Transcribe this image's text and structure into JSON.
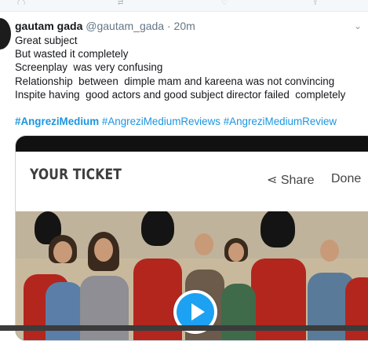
{
  "tweet": {
    "display_name": "gautam gada",
    "handle": "@gautam_gada",
    "separator": " · ",
    "timestamp": "20m",
    "lines": [
      "Great subject",
      "But wasted it completely",
      "Screenplay  was very confusing",
      "Relationship  between  dimple mam and kareena was not convincing",
      "Inspite having  good actors and good subject director failed  completely"
    ],
    "hashtags": [
      "#AngreziMedium",
      "#AngreziMediumReviews",
      "#AngreziMediumReview"
    ]
  },
  "card": {
    "ticket_title": "YOUR TICKET",
    "share_label": "Share",
    "done_label": "Done"
  },
  "colors": {
    "link": "#1b95e0",
    "play_button": "#1da1f2"
  },
  "icons": {
    "share": "share-icon",
    "play": "play-icon",
    "chevron": "chevron-down-icon"
  }
}
